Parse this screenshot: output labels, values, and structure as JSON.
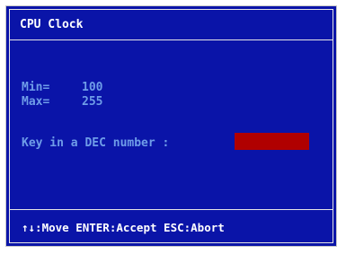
{
  "dialog": {
    "title": "CPU Clock",
    "min_label": "Min=",
    "min_value": "100",
    "max_label": "Max=",
    "max_value": "255",
    "prompt": "Key in a DEC number :",
    "input_value": "",
    "footer": "↑↓:Move ENTER:Accept ESC:Abort"
  },
  "colors": {
    "background": "#0a14a8",
    "border": "#e6e6e6",
    "label_text": "#6f9de8",
    "title_text": "#ffffff",
    "input_field": "#b00000"
  }
}
